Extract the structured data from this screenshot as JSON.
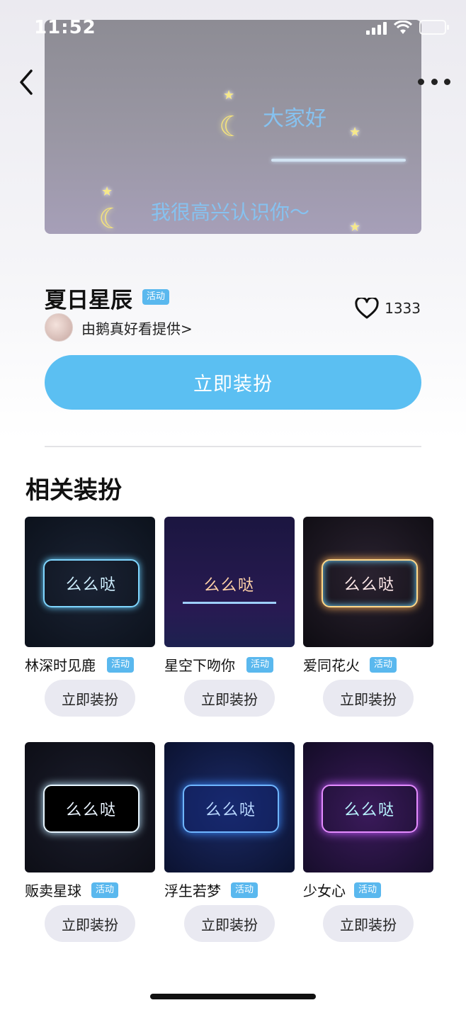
{
  "status_bar": {
    "time": "11:52"
  },
  "preview": {
    "line1": "大家好",
    "line2": "我很高兴认识你～"
  },
  "item": {
    "title": "夏日星辰",
    "tag": "活动",
    "provider": "由鹅真好看提供>",
    "likes": "1333"
  },
  "primary_button": "立即装扮",
  "related": {
    "title": "相关装扮",
    "items": [
      {
        "name": "林深时见鹿",
        "tag": "活动",
        "button": "立即装扮",
        "thumb_text": "么么哒"
      },
      {
        "name": "星空下吻你",
        "tag": "活动",
        "button": "立即装扮",
        "thumb_text": "么么哒"
      },
      {
        "name": "爱同花火",
        "tag": "活动",
        "button": "立即装扮",
        "thumb_text": "么么哒"
      },
      {
        "name": "贩卖星球",
        "tag": "活动",
        "button": "立即装扮",
        "thumb_text": "么么哒"
      },
      {
        "name": "浮生若梦",
        "tag": "活动",
        "button": "立即装扮",
        "thumb_text": "么么哒"
      },
      {
        "name": "少女心",
        "tag": "活动",
        "button": "立即装扮",
        "thumb_text": "么么哒"
      }
    ]
  },
  "colors": {
    "accent": "#5bbff2",
    "tag": "#5ab8ee",
    "secondary_button": "#e9e9f1"
  }
}
